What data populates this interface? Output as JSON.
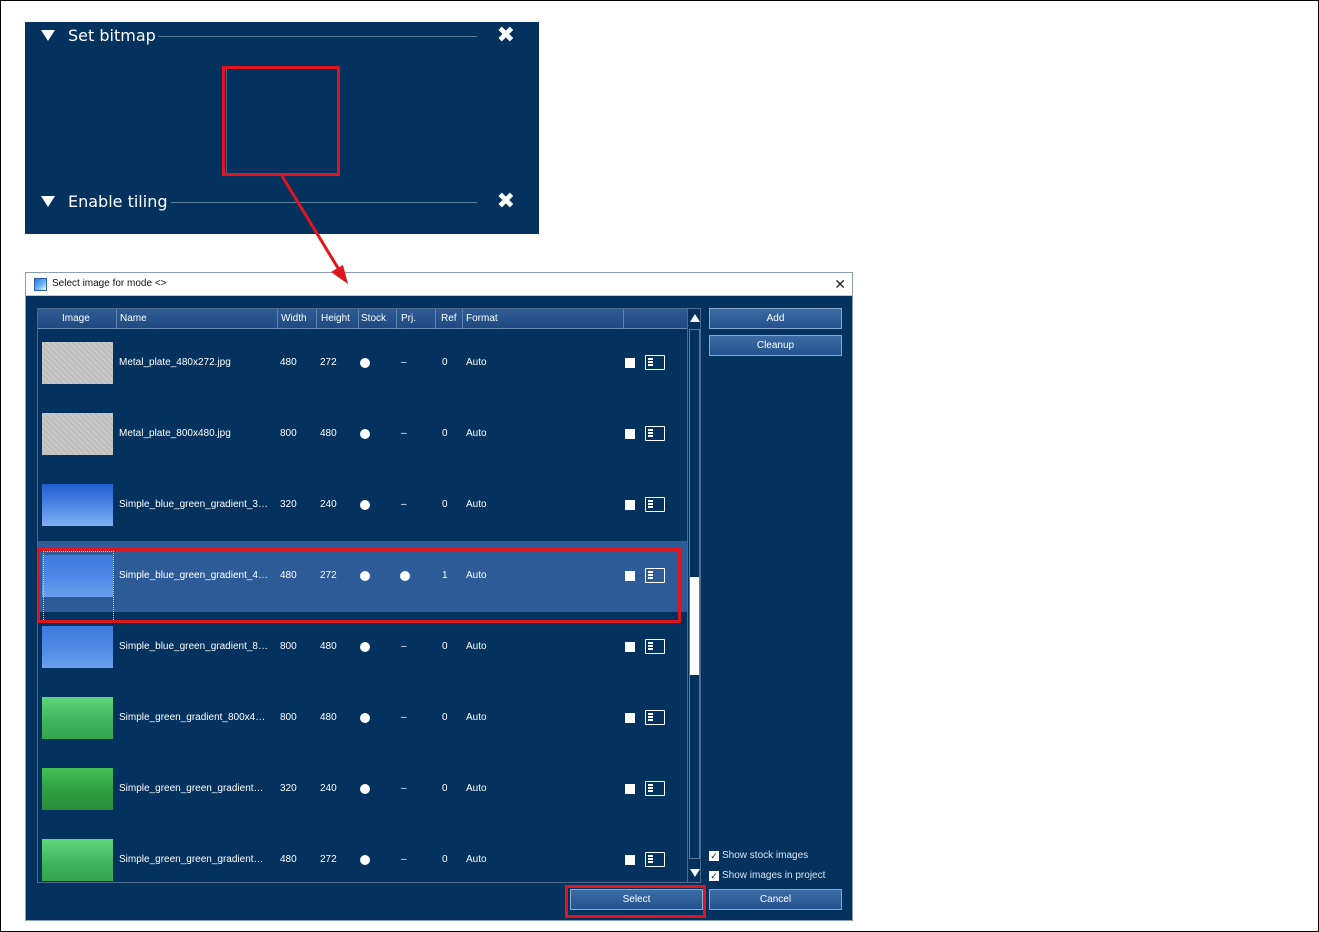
{
  "prop_panel": {
    "section1_label": "Set bitmap",
    "section2_label": "Enable tiling",
    "close_glyph": "✖"
  },
  "dialog": {
    "title": "Select image for mode <>",
    "close_glyph": "✕",
    "columns": [
      "Image",
      "Name",
      "Width",
      "Height",
      "Stock",
      "Prj.",
      "Ref",
      "Format"
    ],
    "rows": [
      {
        "thumb": "metal",
        "name": "Metal_plate_480x272.jpg",
        "width": "480",
        "height": "272",
        "stock": "●",
        "prj": "–",
        "ref": "0",
        "format": "Auto",
        "selected": false
      },
      {
        "thumb": "metal",
        "name": "Metal_plate_800x480.jpg",
        "width": "800",
        "height": "480",
        "stock": "●",
        "prj": "–",
        "ref": "0",
        "format": "Auto",
        "selected": false
      },
      {
        "thumb": "blue",
        "name": "Simple_blue_green_gradient_3…",
        "width": "320",
        "height": "240",
        "stock": "●",
        "prj": "–",
        "ref": "0",
        "format": "Auto",
        "selected": false
      },
      {
        "thumb": "blue2",
        "name": "Simple_blue_green_gradient_4…",
        "width": "480",
        "height": "272",
        "stock": "●",
        "prj": "●",
        "ref": "1",
        "format": "Auto",
        "selected": true
      },
      {
        "thumb": "blue2",
        "name": "Simple_blue_green_gradient_8…",
        "width": "800",
        "height": "480",
        "stock": "●",
        "prj": "–",
        "ref": "0",
        "format": "Auto",
        "selected": false
      },
      {
        "thumb": "green",
        "name": "Simple_green_gradient_800x4…",
        "width": "800",
        "height": "480",
        "stock": "●",
        "prj": "–",
        "ref": "0",
        "format": "Auto",
        "selected": false
      },
      {
        "thumb": "green2",
        "name": "Simple_green_green_gradient…",
        "width": "320",
        "height": "240",
        "stock": "●",
        "prj": "–",
        "ref": "0",
        "format": "Auto",
        "selected": false
      },
      {
        "thumb": "green",
        "name": "Simple_green_green_gradient…",
        "width": "480",
        "height": "272",
        "stock": "●",
        "prj": "–",
        "ref": "0",
        "format": "Auto",
        "selected": false
      }
    ],
    "buttons": {
      "add": "Add",
      "cleanup": "Cleanup",
      "select": "Select",
      "cancel": "Cancel"
    },
    "checkboxes": {
      "show_stock": "Show stock images",
      "show_project": "Show images in project"
    }
  },
  "colors": {
    "panel_bg": "#03325e",
    "selected_row": "#2d5b98",
    "callout": "#e0151d"
  }
}
